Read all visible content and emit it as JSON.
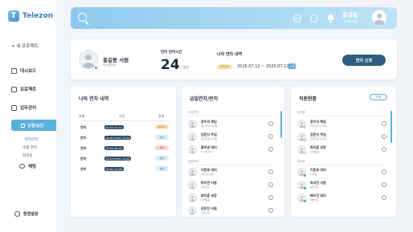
{
  "app": {
    "name": "Telezon"
  },
  "sidebar": {
    "new_project": "+ 새 프로젝트",
    "items": [
      {
        "label": "대시보드"
      },
      {
        "label": "프로젝트"
      },
      {
        "label": "업무관리"
      }
    ],
    "active": {
      "label": "신청/승인"
    },
    "sub_items": [
      {
        "label": "· 연차관리"
      },
      {
        "label": "비품 관리"
      },
      {
        "label": "회의실"
      }
    ],
    "chat": {
      "label": "채팅"
    },
    "settings": {
      "label": "환경설정"
    }
  },
  "header": {
    "user_name": "홍길동",
    "user_dept": "인사총무팀",
    "icon_badge": "En"
  },
  "profile": {
    "name": "홍길동 사원",
    "dept": "인사총무팀",
    "remaining_label": "연차 잔여시간",
    "remaining": "24",
    "total": "/ 80",
    "history_label": "나의 연차 내역",
    "history_badge": "승인완료",
    "history_range": "2025.07.12 ~ 2025.07.12",
    "history_more": "+3",
    "apply_button": "연차 신청"
  },
  "my_leave": {
    "title": "나의 연차 내역",
    "columns": [
      "유형",
      "기간",
      "상태"
    ],
    "rows": [
      {
        "type": "연차",
        "date": "07.10~07.12",
        "status": "결재대기"
      },
      {
        "type": "반차",
        "date": "06.05 12:00~17:00",
        "status": "승인"
      },
      {
        "type": "연차",
        "date": "05.20~05.20",
        "status": "반려"
      },
      {
        "type": "반차",
        "date": "04.15 09:00~13:00",
        "status": "승인"
      },
      {
        "type": "연차",
        "date": "03.02~03.03",
        "status": "승인"
      }
    ]
  },
  "today_leave": {
    "title": "금일연차/반차",
    "sections": [
      {
        "label": "금일연차"
      },
      {
        "label": "금일반차"
      }
    ],
    "people": [
      {
        "name": "장우석 책임",
        "sub": "경영지원 인사팀"
      },
      {
        "name": "김민지 주임",
        "sub": "경영지원 인사팀"
      },
      {
        "name": "황보경 대리",
        "sub": "인사총무팀"
      },
      {
        "name": "이준호 대리",
        "sub": "개발1팀 연차"
      },
      {
        "name": "박서연 사원",
        "sub": "영업2팀"
      },
      {
        "name": "최지훈 과장",
        "sub": "마케팅팀"
      },
      {
        "name": "김유진 사원",
        "sub": "디자인팀"
      }
    ]
  },
  "staff": {
    "title": "직원현황",
    "all_button": "전체",
    "sections": [
      {
        "label": "부재중"
      },
      {
        "label": "재실중"
      }
    ],
    "people": [
      {
        "name": "장우석 책임",
        "sub": "경영지원 인사팀"
      },
      {
        "name": "김민지 주임",
        "sub": "경영지원 인사팀"
      },
      {
        "name": "최지훈 과장",
        "sub": "마케팅팀"
      },
      {
        "name": "이윤호 대리",
        "sub": "기획팀"
      },
      {
        "name": "박서연 사원",
        "sub": "영업2팀"
      },
      {
        "name": "배수진 대리",
        "sub": "개발1팀"
      }
    ]
  },
  "colors": {
    "accent": "#5ab0e0",
    "dark": "#2f5f80",
    "online": "#3dbb6b",
    "offline": "#c7ccd2"
  }
}
